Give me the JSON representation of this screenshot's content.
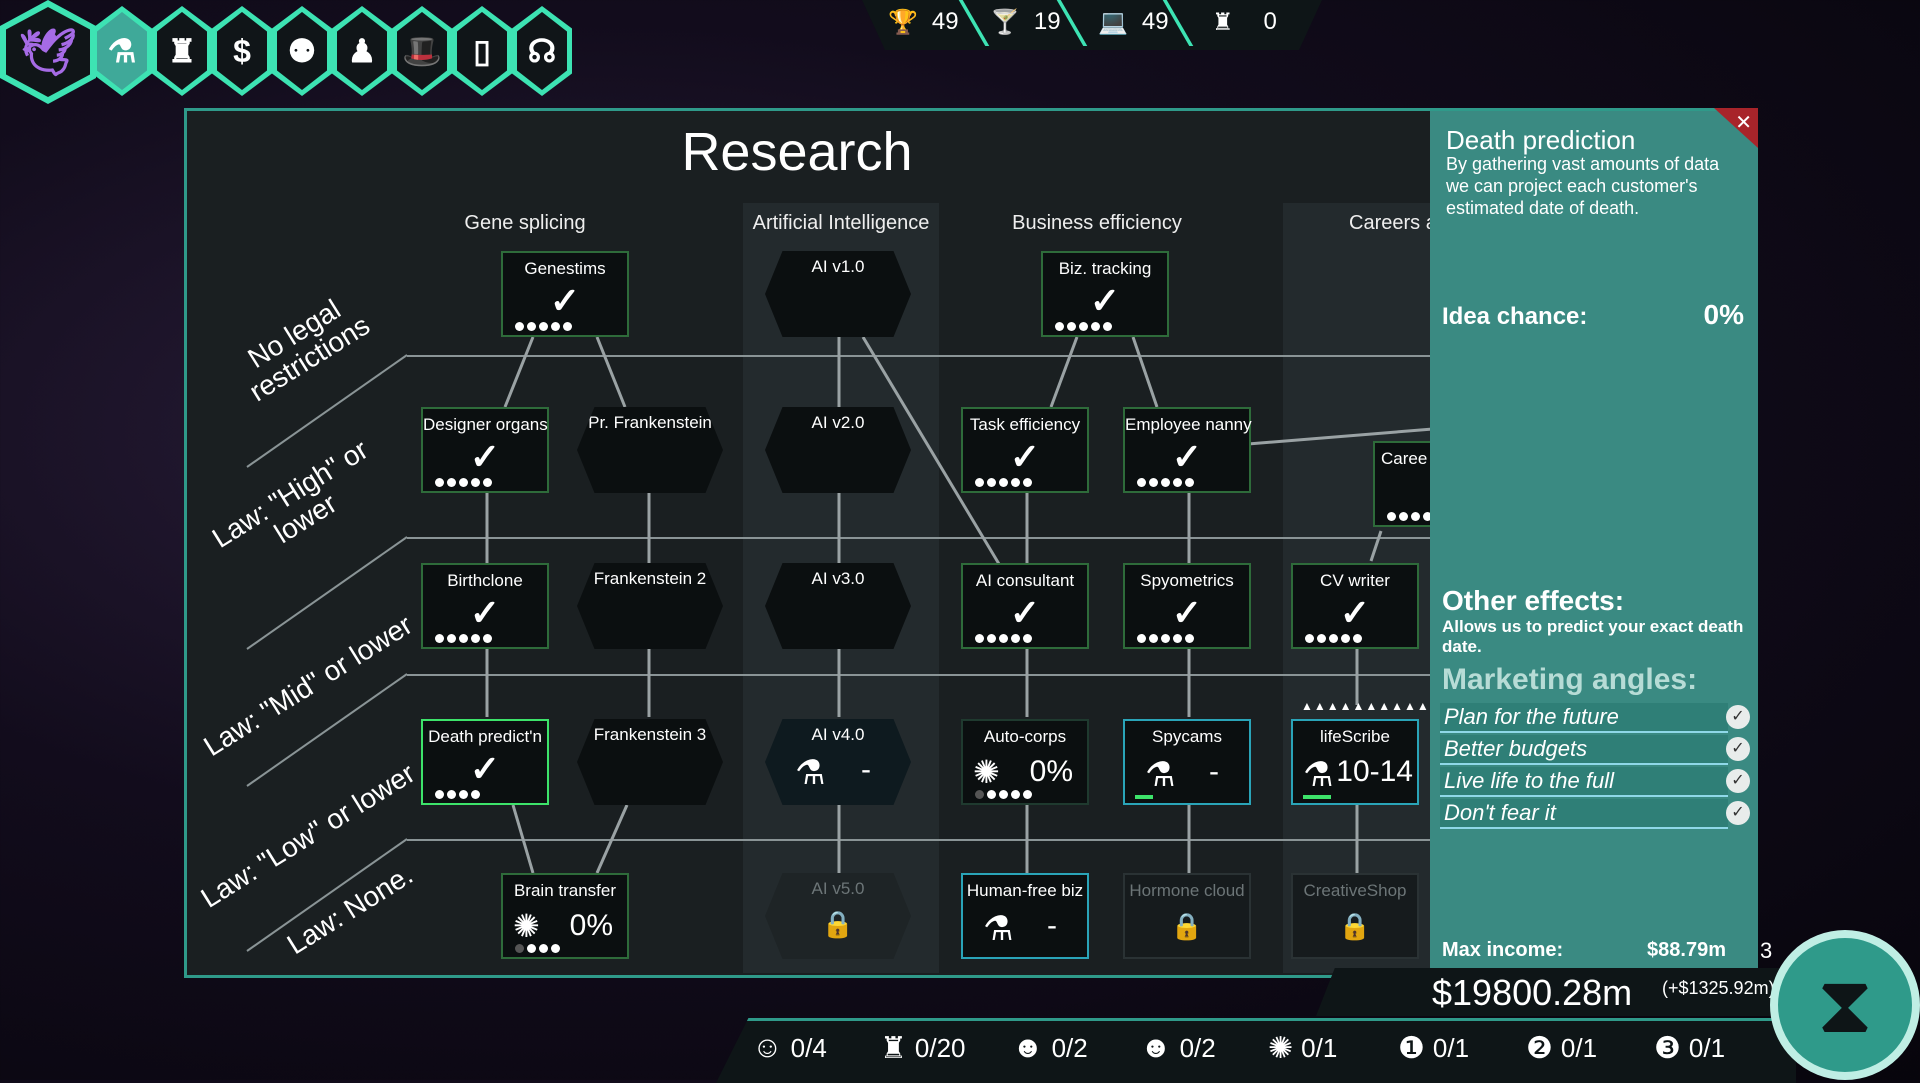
{
  "menu": [
    {
      "icon": "dove-icon",
      "glyph": "🕊"
    },
    {
      "icon": "flask-icon",
      "glyph": "⚗"
    },
    {
      "icon": "staff-icon",
      "glyph": "♜"
    },
    {
      "icon": "dollar-icon",
      "glyph": "$"
    },
    {
      "icon": "people-icon",
      "glyph": "⚉"
    },
    {
      "icon": "chess-icon",
      "glyph": "♟"
    },
    {
      "icon": "spy-hat-icon",
      "glyph": "🎩"
    },
    {
      "icon": "phone-icon",
      "glyph": "▯"
    },
    {
      "icon": "head-icon",
      "glyph": "☊"
    }
  ],
  "top_stats": [
    {
      "icon": "trophy-icon",
      "glyph": "🏆",
      "value": "49"
    },
    {
      "icon": "cocktail-icon",
      "glyph": "🍸",
      "value": "19"
    },
    {
      "icon": "laptop-icon",
      "glyph": "💻",
      "value": "49"
    },
    {
      "icon": "suit-icon",
      "glyph": "♜",
      "value": "0"
    }
  ],
  "panel": {
    "title": "Research",
    "columns": [
      "Gene splicing",
      "Artificial Intelligence",
      "Business efficiency",
      "Careers a"
    ],
    "law_labels": [
      "No legal\nrestrictions",
      "Law: \"High\" or\nlower",
      "Law: \"Mid\" or lower",
      "Law: \"Low\" or lower",
      "Law: None."
    ]
  },
  "nodes": {
    "genestims": {
      "name": "Genestims"
    },
    "ai1": {
      "name": "AI v1.0"
    },
    "biztracking": {
      "name": "Biz. tracking"
    },
    "designerorgans": {
      "name": "Designer organs"
    },
    "prfrank": {
      "name": "Pr. Frankenstein"
    },
    "ai2": {
      "name": "AI v2.0"
    },
    "taskeff": {
      "name": "Task efficiency"
    },
    "nanny": {
      "name": "Employee nanny"
    },
    "careers": {
      "name": "Caree"
    },
    "birthclone": {
      "name": "Birthclone"
    },
    "frank2": {
      "name": "Frankenstein 2"
    },
    "ai3": {
      "name": "AI v3.0"
    },
    "aiconsult": {
      "name": "AI consultant"
    },
    "spyometrics": {
      "name": "Spyometrics"
    },
    "cvwriter": {
      "name": "CV writer"
    },
    "deathpred": {
      "name": "Death predict'n"
    },
    "frank3": {
      "name": "Frankenstein 3"
    },
    "ai4": {
      "name": "AI v4.0",
      "value": "-"
    },
    "autocorps": {
      "name": "Auto-corps",
      "value": "0%"
    },
    "spycams": {
      "name": "Spycams",
      "value": "-"
    },
    "lifescribe": {
      "name": "lifeScribe",
      "value": "10-14",
      "extra": "▲▲▲▲▲▲▲▲▲▲+"
    },
    "braintransfer": {
      "name": "Brain transfer",
      "value": "0%"
    },
    "ai5": {
      "name": "AI v5.0"
    },
    "humanfree": {
      "name": "Human-free biz",
      "value": "-"
    },
    "hormone": {
      "name": "Hormone cloud"
    },
    "creativeshop": {
      "name": "CreativeShop"
    }
  },
  "info": {
    "title": "Death prediction",
    "description": "By gathering vast amounts of data we can project each customer's estimated date of death.",
    "idea_chance_label": "Idea chance:",
    "idea_chance_value": "0%",
    "other_effects_title": "Other effects:",
    "other_effects_text": "Allows us to predict your exact death date.",
    "marketing_title": "Marketing angles:",
    "marketing_angles": [
      "Plan for the future",
      "Better budgets",
      "Live life to the full",
      "Don't fear it"
    ],
    "max_income_label": "Max income:",
    "max_income_value": "$88.79m"
  },
  "money": {
    "total": "$19800.28m",
    "delta": "(+$1325.92m)",
    "side_number": "3"
  },
  "staff": [
    {
      "icon": "scientist-icon",
      "glyph": "☺",
      "value": "0/4"
    },
    {
      "icon": "worker-icon",
      "glyph": "♜",
      "value": "0/20"
    },
    {
      "icon": "manager-icon",
      "glyph": "☻",
      "value": "0/2"
    },
    {
      "icon": "executive-icon",
      "glyph": "☻",
      "value": "0/2"
    },
    {
      "icon": "brain-a-icon",
      "glyph": "✺",
      "value": "0/1"
    },
    {
      "icon": "brain-1-icon",
      "glyph": "❶",
      "value": "0/1"
    },
    {
      "icon": "brain-2-icon",
      "glyph": "❷",
      "value": "0/1"
    },
    {
      "icon": "brain-3-icon",
      "glyph": "❸",
      "value": "0/1"
    }
  ],
  "hourglass": {
    "glyph": "⧗"
  }
}
